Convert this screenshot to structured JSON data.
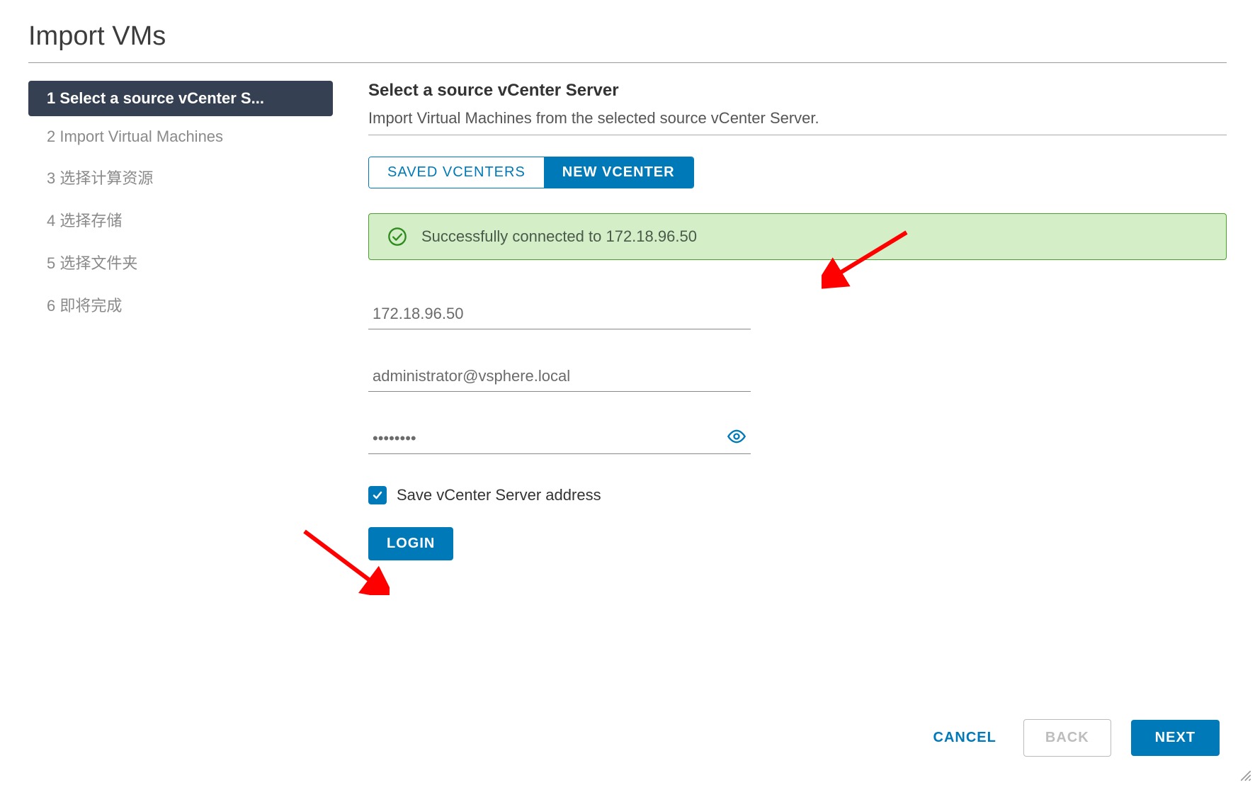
{
  "page_title": "Import VMs",
  "steps": [
    {
      "num": "1",
      "label": "Select a source vCenter S...",
      "active": true,
      "display": "1 Select a source vCenter S..."
    },
    {
      "num": "2",
      "label": "Import Virtual Machines",
      "active": false,
      "display": "2 Import Virtual Machines"
    },
    {
      "num": "3",
      "label": "选择计算资源",
      "active": false,
      "display": "3 选择计算资源"
    },
    {
      "num": "4",
      "label": "选择存储",
      "active": false,
      "display": "4 选择存储"
    },
    {
      "num": "5",
      "label": "选择文件夹",
      "active": false,
      "display": "5 选择文件夹"
    },
    {
      "num": "6",
      "label": "即将完成",
      "active": false,
      "display": "6 即将完成"
    }
  ],
  "content": {
    "title": "Select a source vCenter Server",
    "subtitle": "Import Virtual Machines from the selected source vCenter Server."
  },
  "tabs": {
    "saved": "SAVED VCENTERS",
    "new": "NEW VCENTER"
  },
  "success_message": "Successfully connected to 172.18.96.50",
  "form": {
    "server_address": "172.18.96.50",
    "username": "administrator@vsphere.local",
    "password_mask": "••••••••",
    "save_label": "Save vCenter Server address",
    "login_label": "LOGIN"
  },
  "footer": {
    "cancel": "CANCEL",
    "back": "BACK",
    "next": "NEXT"
  },
  "colors": {
    "primary": "#0079b8",
    "success_bg": "#d4eec7",
    "success_border": "#4aa02c",
    "step_active_bg": "#354152"
  }
}
